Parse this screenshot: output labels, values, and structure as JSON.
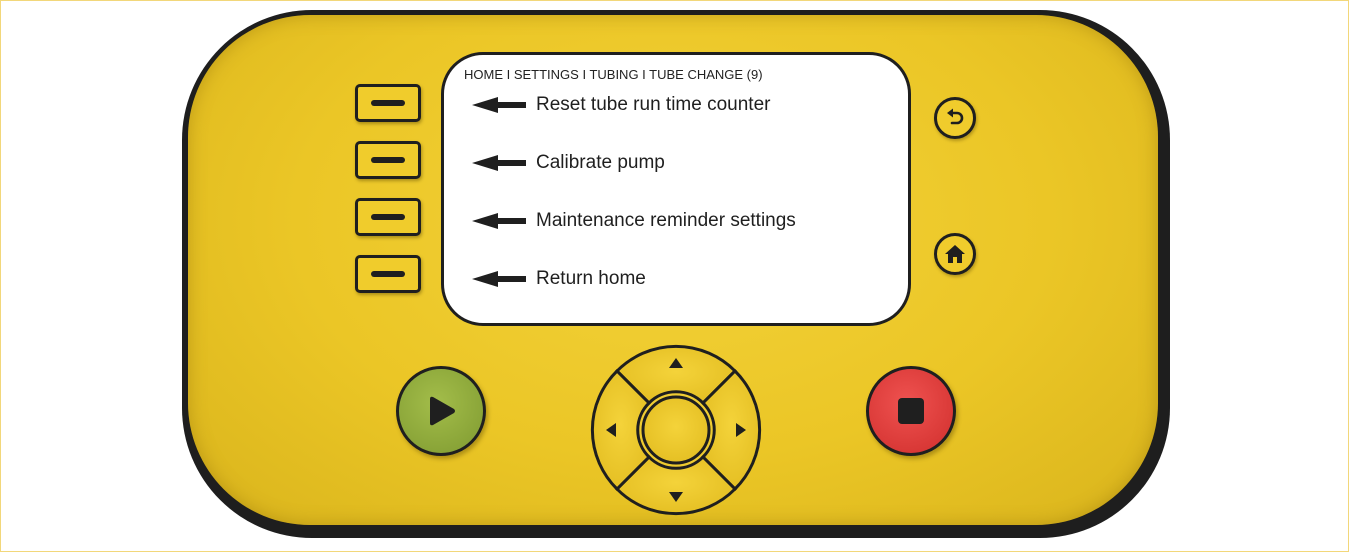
{
  "screen": {
    "breadcrumb": "HOME I SETTINGS I TUBING I TUBE CHANGE (9)",
    "menu": [
      {
        "label": "Reset tube run time counter"
      },
      {
        "label": "Calibrate pump"
      },
      {
        "label": "Maintenance reminder settings"
      },
      {
        "label": "Return home"
      }
    ]
  },
  "buttons": {
    "back": "back-icon",
    "home": "home-icon",
    "start": "play-icon",
    "stop": "stop-icon",
    "dpad": [
      "up-arrow-icon",
      "right-arrow-icon",
      "down-arrow-icon",
      "left-arrow-icon",
      "center"
    ]
  },
  "colors": {
    "body": "#ebc626",
    "start": "#8ea83a",
    "stop": "#e03a38",
    "outline": "#1f1f1f"
  }
}
